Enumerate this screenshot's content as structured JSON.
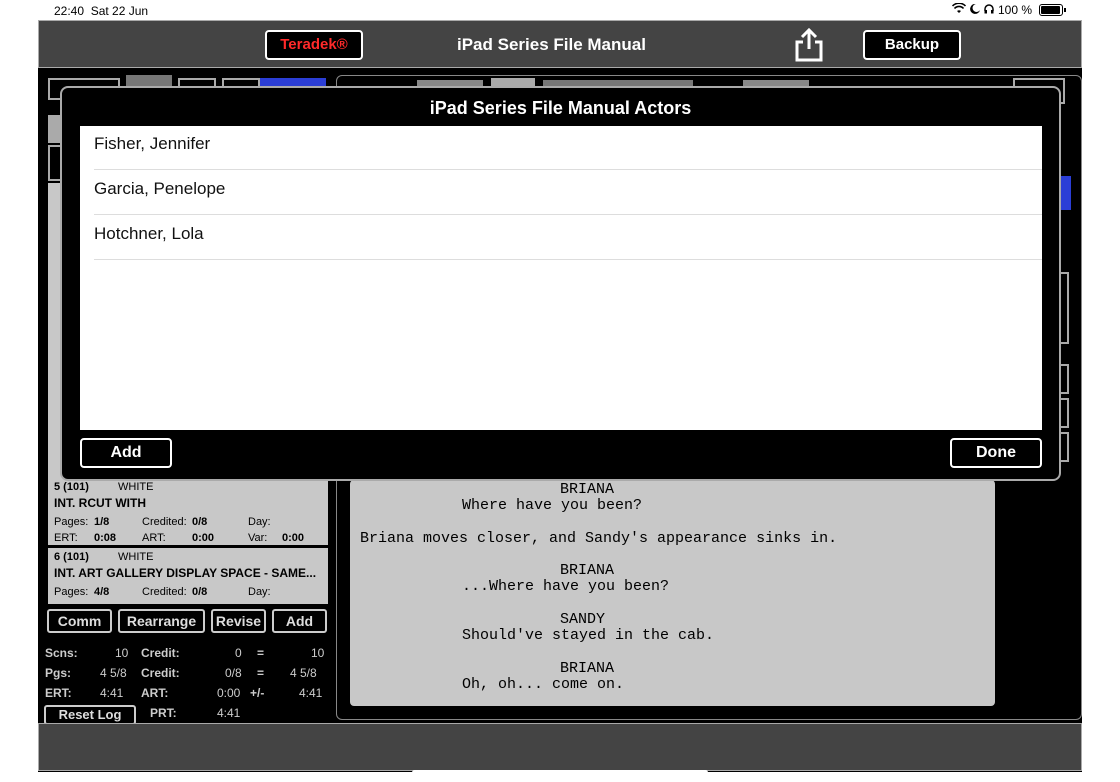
{
  "statusbar": {
    "time": "22:40",
    "date": "Sat 22 Jun",
    "battery": "100 %"
  },
  "topbar": {
    "teradek_label": "Teradek®",
    "title": "iPad Series File Manual",
    "backup_label": "Backup"
  },
  "scenes": [
    {
      "number": "5 (101)",
      "color": "WHITE",
      "heading": "INT. RCUT WITH",
      "pages_label": "Pages:",
      "pages": "1/8",
      "credited_label": "Credited:",
      "credited": "0/8",
      "day_label": "Day:",
      "ert_label": "ERT:",
      "ert": "0:08",
      "art_label": "ART:",
      "art": "0:00",
      "var_label": "Var:",
      "var": "0:00"
    },
    {
      "number": "6 (101)",
      "color": "WHITE",
      "heading": "INT. ART GALLERY DISPLAY SPACE - SAME...",
      "pages_label": "Pages:",
      "pages": "4/8",
      "credited_label": "Credited:",
      "credited": "0/8",
      "day_label": "Day:"
    }
  ],
  "left_buttons": {
    "comm": "Comm",
    "rearrange": "Rearrange",
    "revise": "Revise",
    "add": "Add"
  },
  "stats": {
    "scns_label": "Scns:",
    "scns": "10",
    "credit_label": "Credit:",
    "credit_scns": "0",
    "eq": "=",
    "scns_total": "10",
    "pgs_label": "Pgs:",
    "pgs": "4 5/8",
    "credit_pgs": "0/8",
    "pgs_total": "4 5/8",
    "ert_label": "ERT:",
    "ert": "4:41",
    "art_label": "ART:",
    "art": "0:00",
    "pm": "+/-",
    "art_total": "4:41",
    "reset_log": "Reset Log",
    "prt_label": "PRT:",
    "prt": "4:41"
  },
  "script_lines": [
    "BRIANA",
    "Where have you been?",
    "Briana moves closer, and Sandy's appearance sinks in.",
    "BRIANA",
    "...Where have you been?",
    "SANDY",
    "Should've stayed in the cab.",
    "BRIANA",
    "Oh, oh... come on."
  ],
  "modal": {
    "title": "iPad Series File Manual Actors",
    "actors": [
      "Fisher, Jennifer",
      "Garcia, Penelope",
      "Hotchner, Lola"
    ],
    "add_label": "Add",
    "done_label": "Done"
  },
  "colors": {
    "teradek_red": "#ff2a2a",
    "bar_gray": "#444444",
    "panel_gray": "#c8c8c8"
  }
}
